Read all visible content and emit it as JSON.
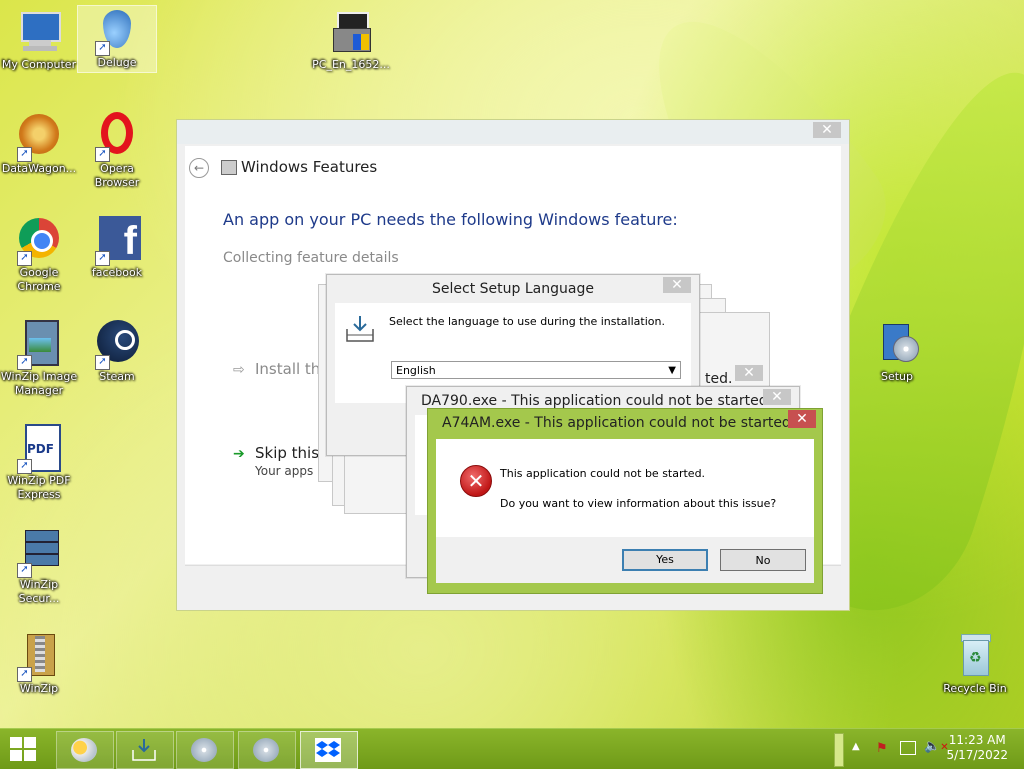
{
  "desktop_icons": [
    {
      "label": "My Computer"
    },
    {
      "label": "Deluge"
    },
    {
      "label": "PC_En_1652..."
    },
    {
      "label": "DataWagon..."
    },
    {
      "label": "Opera Browser"
    },
    {
      "label": "Google Chrome"
    },
    {
      "label": "facebook"
    },
    {
      "label": "WinZip Image Manager"
    },
    {
      "label": "Steam"
    },
    {
      "label": "WinZip PDF Express"
    },
    {
      "label": "WinZip Secur..."
    },
    {
      "label": "WinZip"
    },
    {
      "label": "Setup"
    },
    {
      "label": "Recycle Bin"
    }
  ],
  "windows_features": {
    "title": "Windows Features",
    "heading": "An app on your PC needs the following Windows feature:",
    "collecting": "Collecting feature details",
    "install_option": "Install thi",
    "skip_option": "Skip this",
    "skip_sub": "Your apps m",
    "close": "✕",
    "back": "←"
  },
  "setup_language": {
    "title": "Select Setup Language",
    "message": "Select the language to use during the installation.",
    "selected_language": "English",
    "close": "✕"
  },
  "ghost_text": "ted.",
  "da_dialog": {
    "title": "DA790.exe - This application could not be started.",
    "close": "✕"
  },
  "error_dialog": {
    "title": "A74AM.exe - This application could not be started.",
    "line1": "This application could not be started.",
    "line2": "Do you want to view information about this issue?",
    "yes": "Yes",
    "no": "No",
    "close": "✕"
  },
  "taskbar": {
    "time": "11:23 AM",
    "date": "5/17/2022"
  },
  "colors": {
    "accent": "#a4c84c",
    "taskbar": "#7ea623",
    "error_red": "#c01616",
    "heading_blue": "#1e3a8a"
  }
}
